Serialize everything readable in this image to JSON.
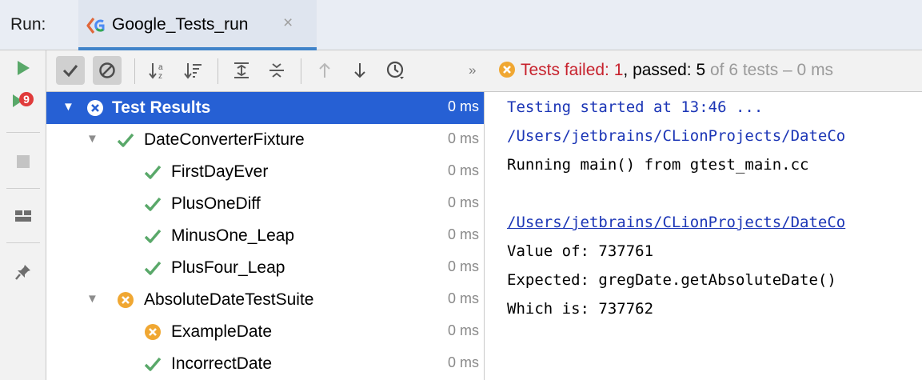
{
  "run_bar": {
    "label": "Run:",
    "tab_label": "Google_Tests_run",
    "close_glyph": "×",
    "tab_icon": "google-test-icon"
  },
  "left_toolbar": {
    "buttons": [
      {
        "name": "rerun-icon",
        "state": "enabled"
      },
      {
        "name": "rerun-failed-tests-icon",
        "state": "enabled"
      },
      {
        "name": "stop-icon",
        "state": "disabled"
      },
      {
        "name": "layout-icon",
        "state": "enabled"
      },
      {
        "name": "pin-tab-icon",
        "state": "enabled"
      }
    ]
  },
  "top_toolbar": {
    "buttons": [
      {
        "name": "show-passed-icon",
        "toggled": true
      },
      {
        "name": "show-ignored-icon",
        "toggled": true
      },
      {
        "name": "sort-alphabetically-icon"
      },
      {
        "name": "sort-by-duration-icon"
      },
      {
        "name": "expand-all-icon"
      },
      {
        "name": "collapse-all-icon"
      },
      {
        "name": "previous-failed-test-icon"
      },
      {
        "name": "next-failed-test-icon"
      },
      {
        "name": "test-history-icon"
      }
    ],
    "overflow": "»",
    "status": {
      "failed_text": "Tests failed: 1",
      "separator": ", ",
      "passed_text": "passed: 5",
      "dim_text": " of 6 tests – 0 ms"
    }
  },
  "tree": {
    "rows": [
      {
        "label": "Test Results",
        "time": "0 ms",
        "status": "failed",
        "level": 0,
        "expanded": true,
        "selected": true
      },
      {
        "label": "DateConverterFixture",
        "time": "0 ms",
        "status": "passed",
        "level": 1,
        "expanded": true
      },
      {
        "label": "FirstDayEver",
        "time": "0 ms",
        "status": "passed",
        "level": 2
      },
      {
        "label": "PlusOneDiff",
        "time": "0 ms",
        "status": "passed",
        "level": 2
      },
      {
        "label": "MinusOne_Leap",
        "time": "0 ms",
        "status": "passed",
        "level": 2
      },
      {
        "label": "PlusFour_Leap",
        "time": "0 ms",
        "status": "passed",
        "level": 2
      },
      {
        "label": "AbsoluteDateTestSuite",
        "time": "0 ms",
        "status": "failed",
        "level": 1,
        "expanded": true
      },
      {
        "label": "ExampleDate",
        "time": "0 ms",
        "status": "failed",
        "level": 2
      },
      {
        "label": "IncorrectDate",
        "time": "0 ms",
        "status": "passed",
        "level": 2
      }
    ]
  },
  "console": {
    "lines": [
      {
        "text": "Testing started at 13:46 ...",
        "style": "blue"
      },
      {
        "text": "/Users/jetbrains/CLionProjects/DateCo",
        "style": "blue"
      },
      {
        "text": "Running main() from gtest_main.cc",
        "style": "normal"
      },
      {
        "text": "",
        "style": "normal"
      },
      {
        "text": "/Users/jetbrains/CLionProjects/DateCo",
        "style": "link"
      },
      {
        "text": "Value of: 737761",
        "style": "normal"
      },
      {
        "text": "Expected: gregDate.getAbsoluteDate()",
        "style": "normal"
      },
      {
        "text": "Which is: 737762",
        "style": "normal"
      }
    ]
  },
  "colors": {
    "selection": "#2660d4",
    "passed": "#59a869",
    "failed": "#f0a732",
    "failed_text": "#c7222d",
    "console_blue": "#1c36b6"
  }
}
